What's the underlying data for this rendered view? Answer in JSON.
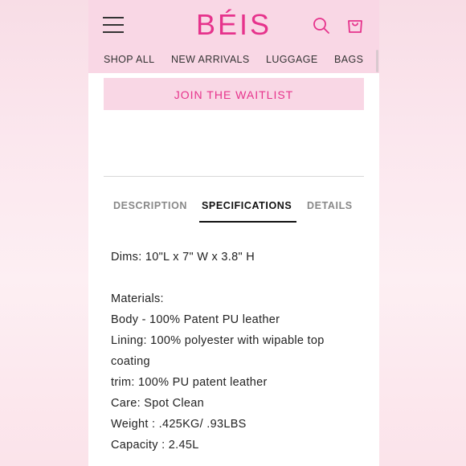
{
  "header": {
    "logo": "BÉIS",
    "nav": [
      "SHOP ALL",
      "NEW ARRIVALS",
      "LUGGAGE",
      "BAGS"
    ]
  },
  "cta": {
    "waitlist_label": "JOIN THE WAITLIST"
  },
  "tabs": {
    "items": [
      "DESCRIPTION",
      "SPECIFICATIONS",
      "DETAILS"
    ],
    "active": "SPECIFICATIONS"
  },
  "specifications": {
    "dims": "Dims: 10\"L x 7\" W x 3.8\" H",
    "materials_heading": "Materials:",
    "body": "Body - 100% Patent PU leather",
    "lining_line1": "Lining: 100% polyester with wipable top",
    "lining_line2": "coating",
    "trim": "trim: 100% PU patent leather",
    "care": "Care: Spot Clean",
    "weight": "Weight : .425KG/ .93LBS",
    "capacity": "Capacity : 2.45L"
  },
  "colors": {
    "brand_pink": "#e6338c",
    "header_bg": "#f9d7e5"
  },
  "icons": [
    "hamburger-menu-icon",
    "search-icon",
    "shopping-bag-icon"
  ]
}
